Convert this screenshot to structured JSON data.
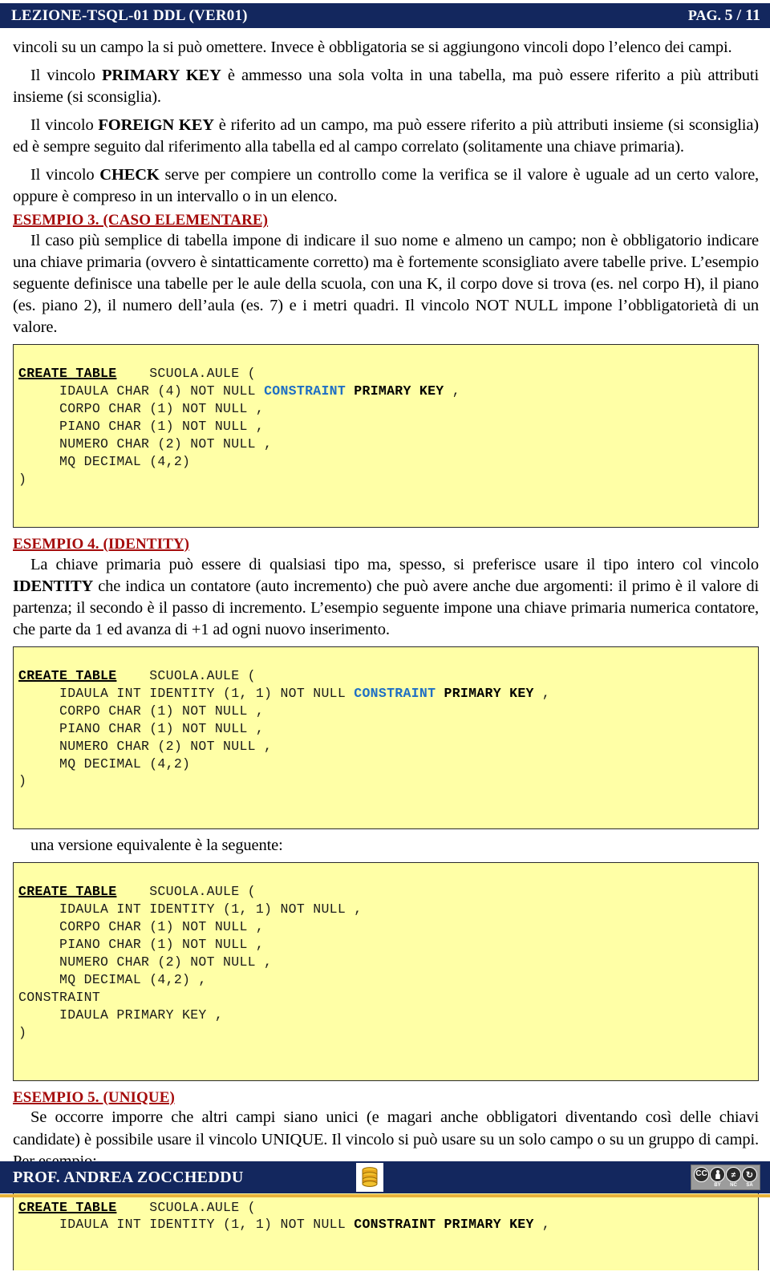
{
  "header": {
    "title": "LEZIONE-TSQL-01 DDL (VER01)",
    "page_label": "PAG.",
    "page_number": "5 / 11",
    "bg_color": "#13275e",
    "text_color": "#ffffff"
  },
  "body": {
    "para_1": "vincoli su un campo la si può omettere. Invece è obbligatoria se si aggiungono vincoli dopo l’elenco dei campi.",
    "para_2_pre": "Il vincolo ",
    "para_2_bold": "PRIMARY KEY",
    "para_2_post": " è ammesso una sola volta in una tabella, ma può essere riferito a più attributi insieme (si sconsiglia).",
    "para_3_pre": "Il vincolo ",
    "para_3_bold": "FOREIGN KEY",
    "para_3_post": " è riferito ad un campo, ma può essere riferito a più attributi insieme (si sconsiglia) ed è sempre seguito dal riferimento alla tabella ed al campo correlato (solitamente una chiave primaria).",
    "para_4_pre": "Il vincolo ",
    "para_4_bold": "CHECK",
    "para_4_post": " serve per compiere un controllo come la verifica se il valore è uguale ad un certo valore, oppure è compreso in un intervallo o in un elenco.",
    "para_5": "Il caso più semplice di tabella impone di indicare il suo nome e almeno un campo; non è obbligatorio indicare una chiave primaria (ovvero è sintatticamente corretto) ma è fortemente sconsigliato avere tabelle prive. L’esempio seguente definisce una tabelle per le aule della scuola, con una K, il corpo dove si trova (es. nel corpo H), il piano (es. piano 2), il numero dell’aula (es. 7) e i metri quadri. Il vincolo NOT NULL impone l’obbligatorietà di un valore.",
    "para_6_pre": "La chiave primaria può essere di qualsiasi tipo ma, spesso, si preferisce usare il tipo intero col vincolo ",
    "para_6_bold": "IDENTITY",
    "para_6_post": " che indica un contatore (auto incremento) che può avere anche due argomenti: il primo è il valore di partenza; il secondo è il passo di incremento. L’esempio seguente impone una chiave primaria numerica contatore, che parte da 1 ed avanza di +1 ad ogni nuovo inserimento.",
    "para_7": "una versione equivalente è la seguente:",
    "para_8": "Se occorre imporre che altri campi siano unici (e magari anche obbligatori diventando così delle chiavi candidate) è possibile usare il vincolo UNIQUE. Il vincolo si può usare su un solo campo o su un gruppo di campi. Per esempio:"
  },
  "headings": {
    "esempio_3": "ESEMPIO 3. (CASO ELEMENTARE)",
    "esempio_4": "ESEMPIO 4. (IDENTITY)",
    "esempio_5": "ESEMPIO 5. (UNIQUE)",
    "color": "#a50b0b"
  },
  "code_style": {
    "bg_color": "#ffffa6",
    "border_color": "#2b2b2b",
    "keyword_blue": "#1f6fc4"
  },
  "code_block_1": {
    "l1_kw": "CREATE TABLE",
    "l1_rest": "    SCUOLA.AULE (",
    "l2_pre": "     IDAULA CHAR (4) NOT NULL ",
    "l2_kw_blue": "CONSTRAINT",
    "l2_kw_bold": " PRIMARY KEY",
    "l2_post": " ,",
    "l3": "     CORPO CHAR (1) NOT NULL ,",
    "l4": "     PIANO CHAR (1) NOT NULL ,",
    "l5": "     NUMERO CHAR (2) NOT NULL ,",
    "l6": "     MQ DECIMAL (4,2)",
    "l7": ")"
  },
  "code_block_2": {
    "l1_kw": "CREATE TABLE",
    "l1_rest": "    SCUOLA.AULE (",
    "l2_pre": "     IDAULA INT IDENTITY (1, 1) NOT NULL ",
    "l2_kw_blue": "CONSTRAINT",
    "l2_kw_bold": " PRIMARY KEY",
    "l2_post": " ,",
    "l3": "     CORPO CHAR (1) NOT NULL ,",
    "l4": "     PIANO CHAR (1) NOT NULL ,",
    "l5": "     NUMERO CHAR (2) NOT NULL ,",
    "l6": "     MQ DECIMAL (4,2)",
    "l7": ")"
  },
  "code_block_3": {
    "l1_kw": "CREATE TABLE",
    "l1_rest": "    SCUOLA.AULE (",
    "l2": "     IDAULA INT IDENTITY (1, 1) NOT NULL ,",
    "l3": "     CORPO CHAR (1) NOT NULL ,",
    "l4": "     PIANO CHAR (1) NOT NULL ,",
    "l5": "     NUMERO CHAR (2) NOT NULL ,",
    "l6": "     MQ DECIMAL (4,2) ,",
    "l7": "CONSTRAINT",
    "l8": "     IDAULA PRIMARY KEY ,",
    "l9": ")"
  },
  "code_block_4": {
    "l1_kw": "CREATE TABLE",
    "l1_rest": "    SCUOLA.AULE (",
    "l2_pre": "     IDAULA INT IDENTITY (1, 1) NOT NULL ",
    "l2_kw_bold": "CONSTRAINT PRIMARY KEY",
    "l2_post": " ,"
  },
  "footer": {
    "author": "PROF. ANDREA ZOCCHEDDU",
    "bg_color": "#13275e",
    "rule_color": "#e8b23a",
    "db_icon": "database-icon",
    "license": {
      "cc": "CC",
      "by_symbol": "\u0001",
      "items": [
        {
          "label": "BY"
        },
        {
          "label": "NC"
        },
        {
          "label": "SA"
        }
      ]
    }
  }
}
